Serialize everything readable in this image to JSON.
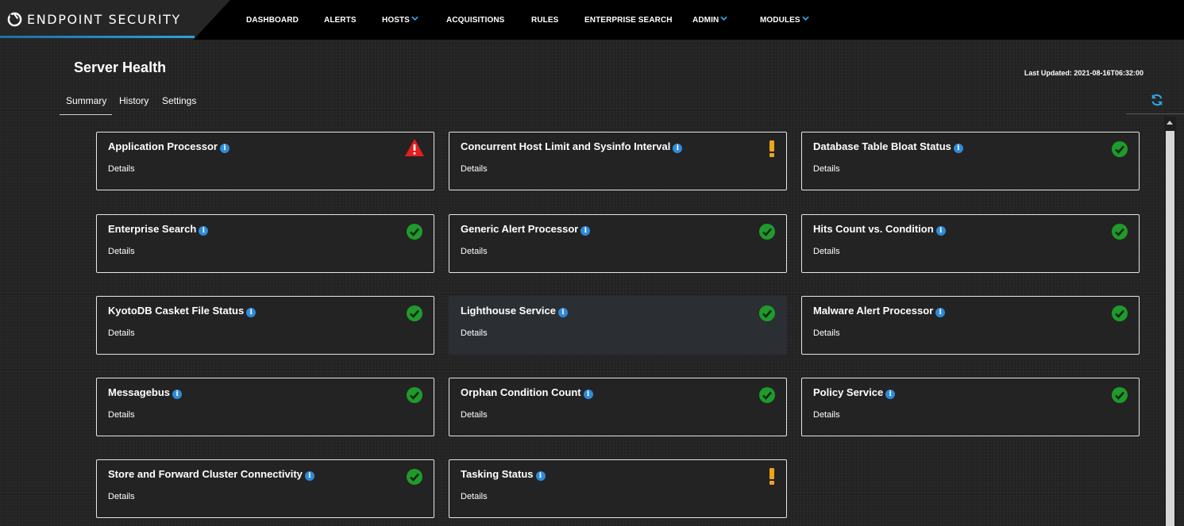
{
  "brand": {
    "name": "ENDPOINT SECURITY",
    "logo_icon": "endpoint-logo-icon"
  },
  "nav": [
    {
      "label": "DASHBOARD",
      "dropdown": false
    },
    {
      "label": "ALERTS",
      "dropdown": false
    },
    {
      "label": "HOSTS",
      "dropdown": true
    },
    {
      "label": "ACQUISITIONS",
      "dropdown": false
    },
    {
      "label": "RULES",
      "dropdown": false
    },
    {
      "label": "ENTERPRISE SEARCH",
      "dropdown": false
    },
    {
      "label": "ADMIN",
      "dropdown": true
    },
    {
      "label": "MODULES",
      "dropdown": true
    }
  ],
  "page": {
    "title": "Server Health",
    "last_updated": "Last Updated: 2021-08-16T06:32:00"
  },
  "tabs": [
    {
      "label": "Summary",
      "active": true
    },
    {
      "label": "History",
      "active": false
    },
    {
      "label": "Settings",
      "active": false
    }
  ],
  "cards": [
    {
      "title": "Application Processor",
      "details": "Details",
      "status": "error"
    },
    {
      "title": "Concurrent Host Limit and Sysinfo Interval",
      "details": "Details",
      "status": "warning"
    },
    {
      "title": "Database Table Bloat Status",
      "details": "Details",
      "status": "ok"
    },
    {
      "title": "Enterprise Search",
      "details": "Details",
      "status": "ok"
    },
    {
      "title": "Generic Alert Processor",
      "details": "Details",
      "status": "ok"
    },
    {
      "title": "Hits Count vs. Condition",
      "details": "Details",
      "status": "ok"
    },
    {
      "title": "KyotoDB Casket File Status",
      "details": "Details",
      "status": "ok"
    },
    {
      "title": "Lighthouse Service",
      "details": "Details",
      "status": "ok"
    },
    {
      "title": "Malware Alert Processor",
      "details": "Details",
      "status": "ok"
    },
    {
      "title": "Messagebus",
      "details": "Details",
      "status": "ok"
    },
    {
      "title": "Orphan Condition Count",
      "details": "Details",
      "status": "ok"
    },
    {
      "title": "Policy Service",
      "details": "Details",
      "status": "ok"
    },
    {
      "title": "Store and Forward Cluster Connectivity",
      "details": "Details",
      "status": "ok"
    },
    {
      "title": "Tasking Status",
      "details": "Details",
      "status": "warning"
    }
  ],
  "colors": {
    "ok": "#1f9a2b",
    "warning": "#f0a21b",
    "error": "#e02020",
    "info": "#2f8ad9",
    "accent": "#2aa3e0"
  }
}
